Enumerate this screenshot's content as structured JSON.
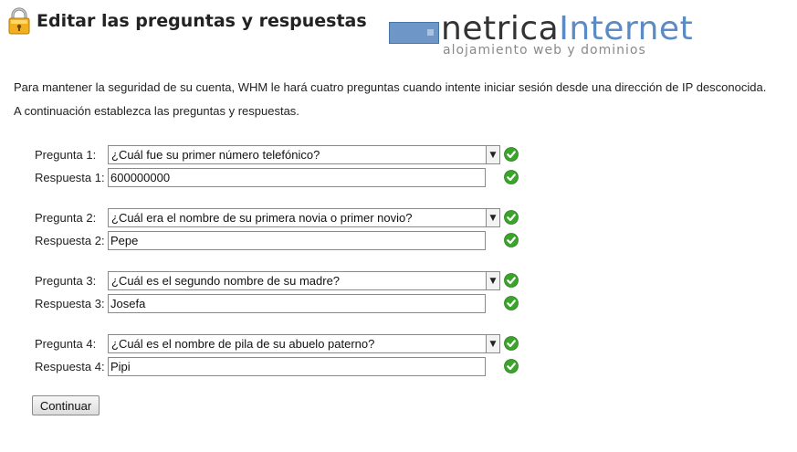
{
  "page": {
    "title": "Editar las preguntas y respuestas",
    "icon": "lock-icon"
  },
  "logo": {
    "name_part1": "netrica",
    "name_part2": "Internet",
    "tagline": "alojamiento web y dominios"
  },
  "intro": {
    "line1": "Para mantener la seguridad de su cuenta, WHM le hará cuatro preguntas cuando intente iniciar sesión desde una dirección de IP desconocida.",
    "line2": "A continuación establezca las preguntas y respuestas."
  },
  "questions": [
    {
      "question_label": "Pregunta 1:",
      "question_value": "¿Cuál fue su primer número telefónico?",
      "answer_label": "Respuesta 1:",
      "answer_value": "600000000"
    },
    {
      "question_label": "Pregunta 2:",
      "question_value": "¿Cuál era el nombre de su primera novia o primer novio?",
      "answer_label": "Respuesta 2:",
      "answer_value": "Pepe"
    },
    {
      "question_label": "Pregunta 3:",
      "question_value": "¿Cuál es el segundo nombre de su madre?",
      "answer_label": "Respuesta 3:",
      "answer_value": "Josefa"
    },
    {
      "question_label": "Pregunta 4:",
      "question_value": "¿Cuál es el nombre de pila de su abuelo paterno?",
      "answer_label": "Respuesta 4:",
      "answer_value": "Pipi"
    }
  ],
  "status_icon": "check-circle-icon",
  "colors": {
    "check": "#3aa52a",
    "logo_blue": "#5b8bc4",
    "logo_dark": "#333333"
  },
  "submit_label": "Continuar"
}
